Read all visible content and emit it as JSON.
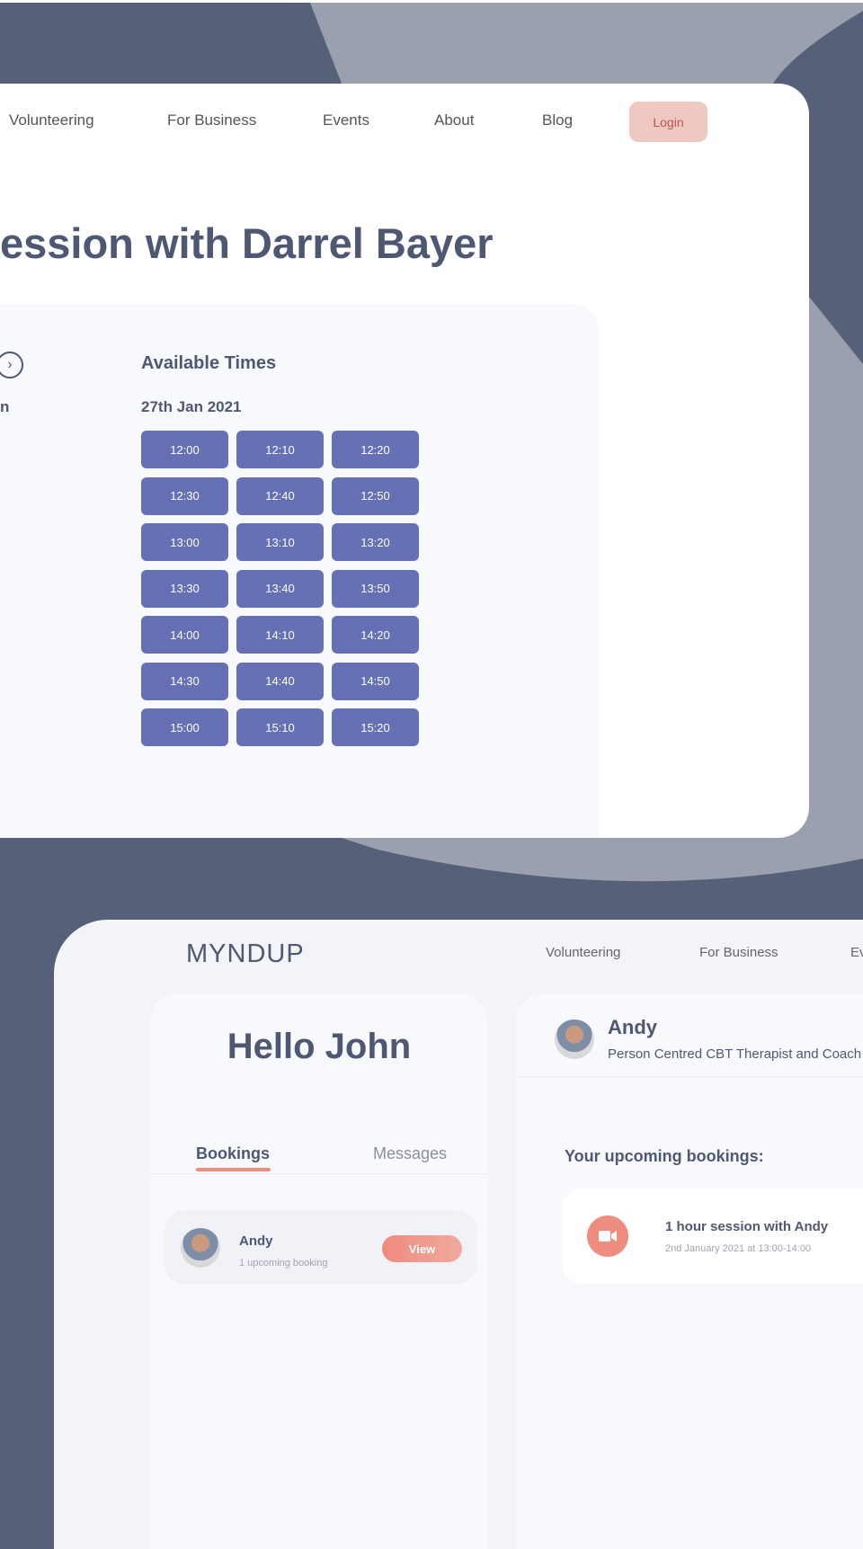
{
  "colors": {
    "background": "#566079",
    "shape": "#9aa0ae",
    "slot": "#6670b5",
    "accent": "#ee8c7f",
    "login_bg": "#efc8c1",
    "text": "#4f5872"
  },
  "booking_page": {
    "nav": [
      "Volunteering",
      "For Business",
      "Events",
      "About",
      "Blog"
    ],
    "login": "Login",
    "title": "ession with Darrel Bayer",
    "calendar_fragment": "n",
    "next_icon": "chevron-right-circle-icon",
    "available_times": "Available Times",
    "date": "27th Jan 2021",
    "slots": [
      "12:00",
      "12:10",
      "12:20",
      "12:30",
      "12:40",
      "12:50",
      "13:00",
      "13:10",
      "13:20",
      "13:30",
      "13:40",
      "13:50",
      "14:00",
      "14:10",
      "14:20",
      "14:30",
      "14:40",
      "14:50",
      "15:00",
      "15:10",
      "15:20"
    ]
  },
  "dashboard": {
    "logo": "MYNDUP",
    "nav": [
      "Volunteering",
      "For Business",
      "Ev"
    ],
    "greeting": "Hello John",
    "tabs": [
      {
        "label": "Bookings",
        "active": true
      },
      {
        "label": "Messages",
        "active": false
      }
    ],
    "contact": {
      "name": "Andy",
      "subtitle": "1 upcoming booking",
      "button": "View"
    },
    "profile": {
      "name": "Andy",
      "role": "Person Centred CBT Therapist and Coach"
    },
    "upcoming_heading": "Your upcoming bookings:",
    "booking": {
      "title": "1 hour session with Andy",
      "when": "2nd January 2021 at 13:00-14:00",
      "icon": "video-camera-icon"
    }
  }
}
